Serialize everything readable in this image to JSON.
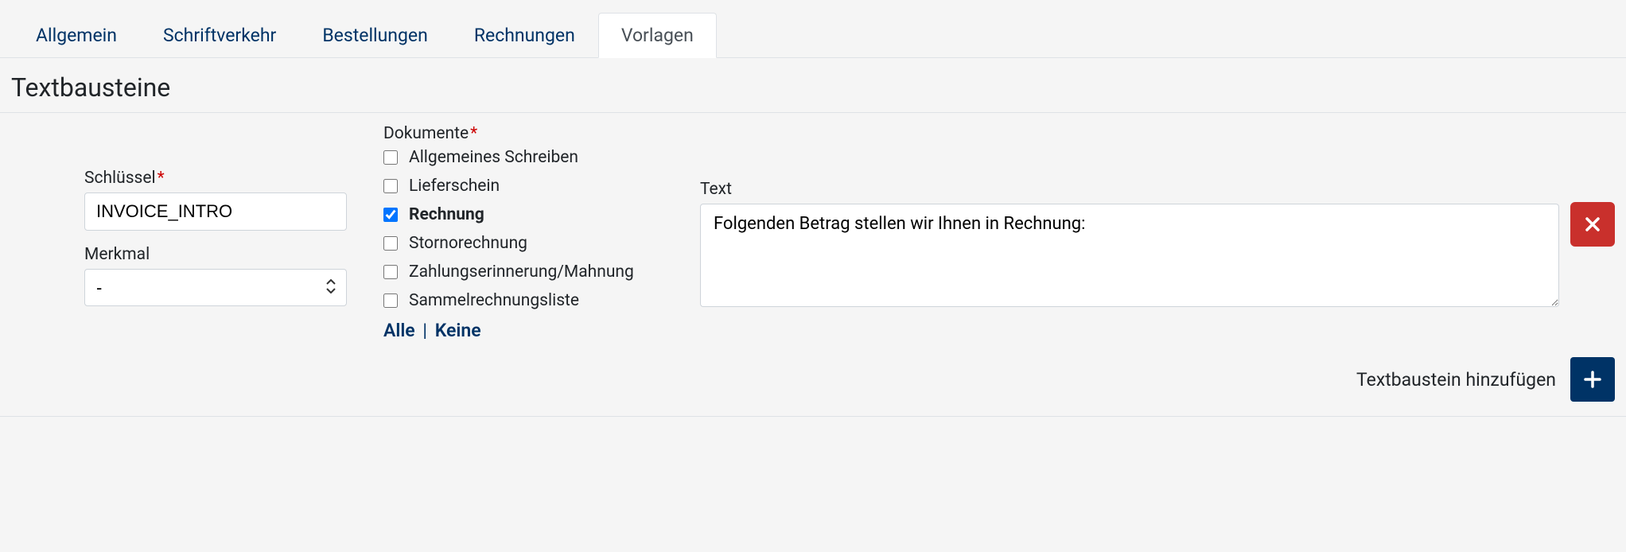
{
  "tabs": {
    "items": [
      {
        "label": "Allgemein",
        "active": false
      },
      {
        "label": "Schriftverkehr",
        "active": false
      },
      {
        "label": "Bestellungen",
        "active": false
      },
      {
        "label": "Rechnungen",
        "active": false
      },
      {
        "label": "Vorlagen",
        "active": true
      }
    ]
  },
  "section_title": "Textbausteine",
  "key": {
    "label": "Schlüssel",
    "value": "INVOICE_INTRO"
  },
  "attribute": {
    "label": "Merkmal",
    "selected": "-"
  },
  "documents": {
    "label": "Dokumente",
    "items": [
      {
        "label": "Allgemeines Schreiben",
        "checked": false
      },
      {
        "label": "Lieferschein",
        "checked": false
      },
      {
        "label": "Rechnung",
        "checked": true
      },
      {
        "label": "Stornorechnung",
        "checked": false
      },
      {
        "label": "Zahlungserinnerung/Mahnung",
        "checked": false
      },
      {
        "label": "Sammelrechnungsliste",
        "checked": false
      }
    ],
    "all": "Alle",
    "none": "Keine"
  },
  "text": {
    "label": "Text",
    "value": "Folgenden Betrag stellen wir Ihnen in Rechnung:"
  },
  "footer": {
    "add_label": "Textbaustein hinzufügen"
  }
}
